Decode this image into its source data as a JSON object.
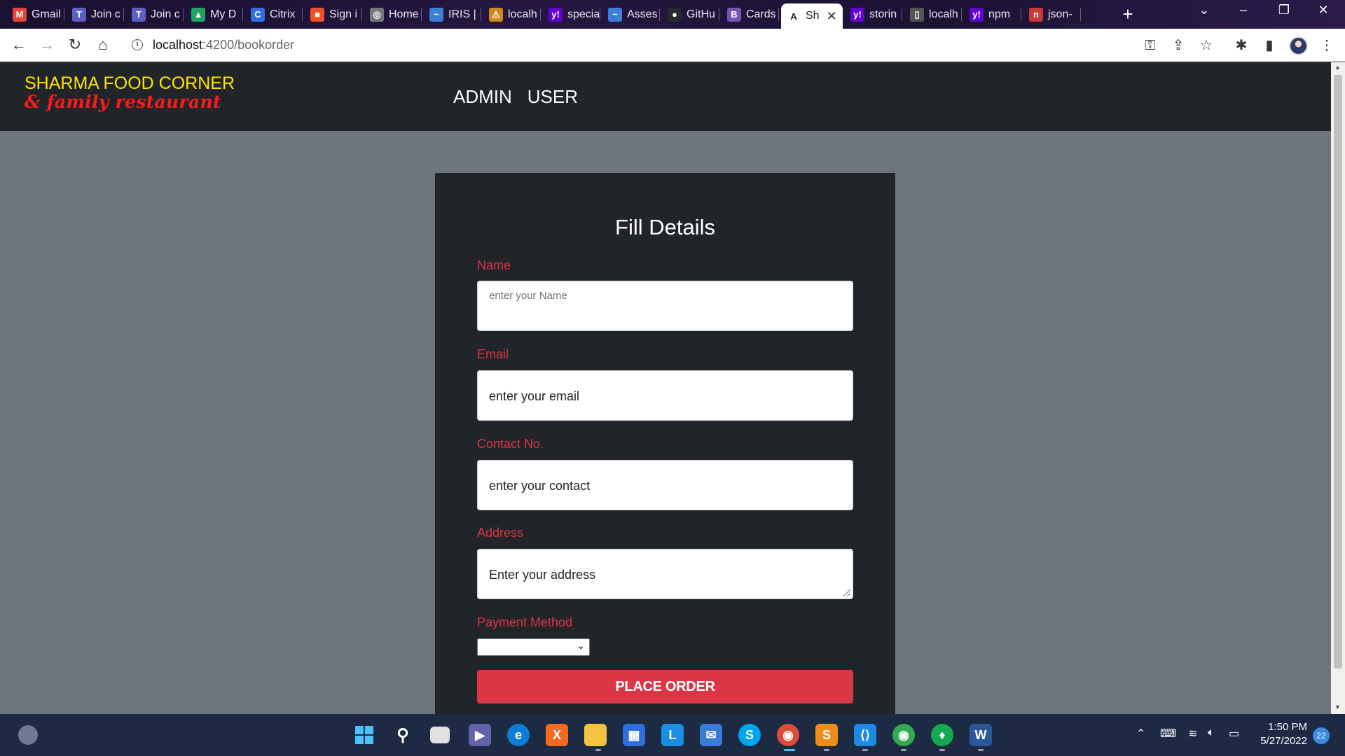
{
  "browser": {
    "tabs": [
      {
        "label": "Gmail",
        "icon": "gmail-icon",
        "color": "#ea4335",
        "glyph": "M"
      },
      {
        "label": "Join c",
        "icon": "teams-icon",
        "color": "#5b5fc7",
        "glyph": "T"
      },
      {
        "label": "Join c",
        "icon": "teams-icon",
        "color": "#5b5fc7",
        "glyph": "T"
      },
      {
        "label": "My D",
        "icon": "drive-icon",
        "color": "#1fa463",
        "glyph": "▲"
      },
      {
        "label": "Citrix",
        "icon": "citrix-icon",
        "color": "#2f6ee0",
        "glyph": "C"
      },
      {
        "label": "Sign i",
        "icon": "microsoft-icon",
        "color": "#f25022",
        "glyph": "■"
      },
      {
        "label": "Home",
        "icon": "globe-icon",
        "color": "#777777",
        "glyph": "◎"
      },
      {
        "label": "IRIS |",
        "icon": "iris-icon",
        "color": "#3b7fd8",
        "glyph": "~"
      },
      {
        "label": "localh",
        "icon": "warning-icon",
        "color": "#d08a1e",
        "glyph": "⚠"
      },
      {
        "label": "specia",
        "icon": "yahoo-icon",
        "color": "#6001d2",
        "glyph": "y!"
      },
      {
        "label": "Asses",
        "icon": "iris-icon",
        "color": "#3b7fd8",
        "glyph": "~"
      },
      {
        "label": "GitHu",
        "icon": "github-icon",
        "color": "#24292e",
        "glyph": "●"
      },
      {
        "label": "Cards",
        "icon": "bootstrap-icon",
        "color": "#7952b3",
        "glyph": "B"
      },
      {
        "label": "Sh",
        "icon": "angular-icon",
        "color": "#ffffff",
        "glyph": "A",
        "active": true
      },
      {
        "label": "storin",
        "icon": "yahoo-icon",
        "color": "#6001d2",
        "glyph": "y!"
      },
      {
        "label": "localh",
        "icon": "page-icon",
        "color": "#555555",
        "glyph": "▯"
      },
      {
        "label": "npm",
        "icon": "yahoo-icon",
        "color": "#6001d2",
        "glyph": "y!"
      },
      {
        "label": "json-",
        "icon": "npm-icon",
        "color": "#cb3837",
        "glyph": "n"
      }
    ],
    "url_host": "localhost",
    "url_path": ":4200/bookorder"
  },
  "site": {
    "brand_line1": "SHARMA FOOD CORNER",
    "brand_line2": "& family restaurant",
    "nav": [
      "ADMIN",
      "USER"
    ]
  },
  "form": {
    "title": "Fill Details",
    "name_label": "Name",
    "name_placeholder": "enter your Name",
    "email_label": "Email",
    "email_placeholder": "enter your email",
    "contact_label": "Contact No.",
    "contact_placeholder": "enter your contact",
    "address_label": "Address",
    "address_placeholder": "Enter your address",
    "payment_label": "Payment Method",
    "payment_value": "",
    "submit_label": "PLACE ORDER"
  },
  "taskbar": {
    "time": "1:50 PM",
    "date": "5/27/2022",
    "notifications": "22"
  },
  "colors": {
    "accent_red": "#dc3545",
    "brand_yellow": "#ffe500",
    "navbar_dark": "#212529",
    "page_gray": "#6c757d"
  }
}
